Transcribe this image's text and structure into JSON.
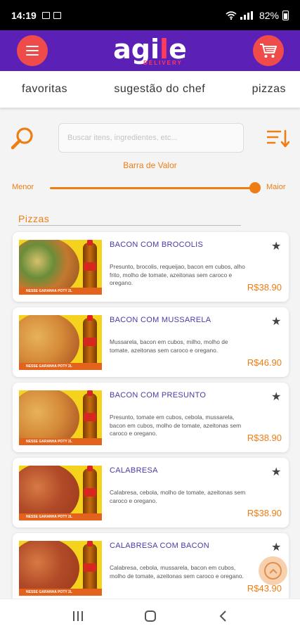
{
  "status_bar": {
    "time": "14:19",
    "battery": "82%"
  },
  "header": {
    "logo_prefix": "agi",
    "logo_accent": "l",
    "logo_suffix": "e",
    "logo_sub": "DELIVERY",
    "colors": {
      "bar": "#5b20b6",
      "button": "#ef4b4b"
    }
  },
  "tabs": [
    "favoritas",
    "sugestão do chef",
    "pizzas"
  ],
  "search": {
    "placeholder": "Buscar itens, ingredientes, etc..."
  },
  "price_filter": {
    "title": "Barra de Valor",
    "min_label": "Menor",
    "max_label": "Maior",
    "value_fraction": 1.0
  },
  "section": {
    "title": "Pizzas"
  },
  "products": [
    {
      "name": "BACON COM BROCOLIS",
      "description": "Presunto, brocolis, requeijao, bacon em cubos, alho frito, molho de tomate, azeitonas sem caroco e oregano.",
      "price": "R$38.90"
    },
    {
      "name": "BACON COM MUSSARELA",
      "description": "Mussarela, bacon em cubos, milho, molho de tomate, azeitonas sem caroco e oregano.",
      "price": "R$46.90"
    },
    {
      "name": "BACON COM PRESUNTO",
      "description": "Presunto, tomate em cubos, cebola, mussarela, bacon em cubos, molho de tomate, azeitonas sem caroco e oregano.",
      "price": "R$38.90"
    },
    {
      "name": "CALABRESA",
      "description": "Calabresa, cebola, molho de tomate, azeitonas sem caroco e oregano.",
      "price": "R$38.90"
    },
    {
      "name": "CALABRESA COM BACON",
      "description": "Calabresa, cebola, mussarela, bacon em cubos, molho de tomate, azeitonas sem caroco e oregano.",
      "price": "R$43.90"
    }
  ],
  "promo_strip": "NESSE GARANHA POTY 2L",
  "accent_color": "#ee7d14"
}
